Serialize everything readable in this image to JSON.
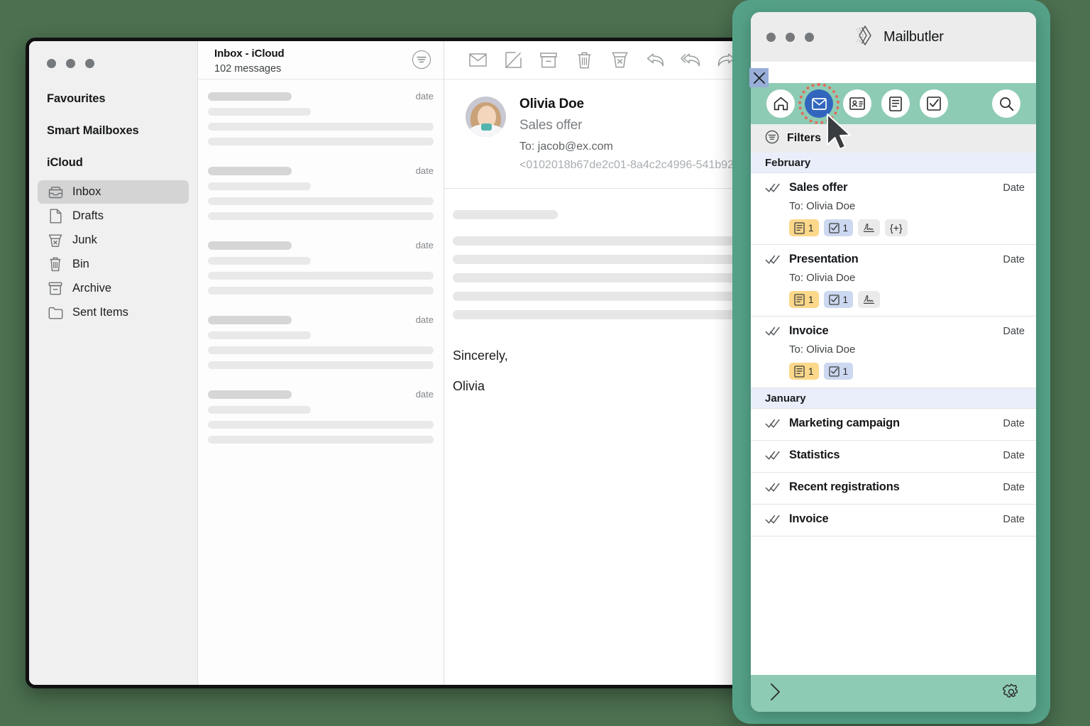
{
  "background_color": "#4c7050",
  "mail_app": {
    "traffic_lights": [
      "close",
      "minimize",
      "zoom"
    ],
    "sidebar": {
      "groups": [
        {
          "label": "Favourites"
        },
        {
          "label": "Smart Mailboxes"
        },
        {
          "label": "iCloud"
        }
      ],
      "mailboxes": [
        {
          "label": "Inbox",
          "icon": "inbox-icon",
          "selected": true
        },
        {
          "label": "Drafts",
          "icon": "document-icon",
          "selected": false
        },
        {
          "label": "Junk",
          "icon": "junk-icon",
          "selected": false
        },
        {
          "label": "Bin",
          "icon": "trash-icon",
          "selected": false
        },
        {
          "label": "Archive",
          "icon": "archive-icon",
          "selected": false
        },
        {
          "label": "Sent Items",
          "icon": "folder-icon",
          "selected": false
        }
      ]
    },
    "message_list": {
      "title": "Inbox - iCloud",
      "count_label": "102 messages",
      "sort_icon": "sort-filter-icon",
      "placeholder_date": "date",
      "skeleton_rows": 5
    },
    "toolbar": [
      {
        "name": "mark-unread-button",
        "icon": "envelope-icon"
      },
      {
        "name": "compose-button",
        "icon": "compose-icon"
      },
      {
        "name": "archive-button",
        "icon": "archive-icon"
      },
      {
        "name": "delete-button",
        "icon": "trash-icon"
      },
      {
        "name": "junk-button",
        "icon": "junk-icon"
      },
      {
        "name": "reply-button",
        "icon": "reply-icon"
      },
      {
        "name": "reply-all-button",
        "icon": "reply-all-icon"
      },
      {
        "name": "forward-button",
        "icon": "forward-icon"
      }
    ],
    "reading_pane": {
      "sender": "Olivia Doe",
      "subject": "Sales offer",
      "to": "To: jacob@ex.com",
      "message_id": "<0102018b67de2c01-8a4c2c4996-541b92",
      "signoff_line1": "Sincerely,",
      "signoff_line2": "Olivia"
    }
  },
  "mailbutler": {
    "titlebar": {
      "brand": "Mailbutler",
      "logo_icon": "mailbutler-diamond-logo"
    },
    "close_badge": {
      "icon": "close-x-icon",
      "color": "#98aed8"
    },
    "toolbar": {
      "accent_color": "#8ecbb4",
      "active_color": "#3266bd",
      "highlight_ring_color": "#e2695b",
      "items": [
        {
          "name": "home-tab",
          "icon": "home-icon",
          "active": false
        },
        {
          "name": "messages-tab",
          "icon": "envelope-icon",
          "active": true,
          "highlighted": true
        },
        {
          "name": "contacts-tab",
          "icon": "contact-card-icon",
          "active": false
        },
        {
          "name": "notes-tab",
          "icon": "notes-icon",
          "active": false
        },
        {
          "name": "tasks-tab",
          "icon": "checkbox-icon",
          "active": false
        }
      ],
      "search": {
        "name": "search-button",
        "icon": "search-icon"
      }
    },
    "filters_row": {
      "label": "Filters",
      "icon": "filter-icon"
    },
    "sections": [
      {
        "month": "February",
        "items": [
          {
            "title": "Sales offer",
            "to": "To: Olivia Doe",
            "date": "Date",
            "status_icon": "double-check-icon",
            "badges": [
              {
                "type": "note",
                "icon": "note-icon",
                "count": "1"
              },
              {
                "type": "task",
                "icon": "task-icon",
                "count": "1"
              },
              {
                "type": "sig",
                "icon": "signature-icon",
                "count": ""
              },
              {
                "type": "tpl",
                "icon": "template-icon",
                "count": "{+}"
              }
            ]
          },
          {
            "title": "Presentation",
            "to": "To: Olivia Doe",
            "date": "Date",
            "status_icon": "double-check-icon",
            "badges": [
              {
                "type": "note",
                "icon": "note-icon",
                "count": "1"
              },
              {
                "type": "task",
                "icon": "task-icon",
                "count": "1"
              },
              {
                "type": "sig",
                "icon": "signature-icon",
                "count": ""
              }
            ]
          },
          {
            "title": "Invoice",
            "to": "To: Olivia Doe",
            "date": "Date",
            "status_icon": "double-check-icon",
            "badges": [
              {
                "type": "note",
                "icon": "note-icon",
                "count": "1"
              },
              {
                "type": "task",
                "icon": "task-icon",
                "count": "1"
              }
            ]
          }
        ]
      },
      {
        "month": "January",
        "items": [
          {
            "title": "Marketing campaign",
            "date": "Date",
            "status_icon": "double-check-icon",
            "compact": true
          },
          {
            "title": "Statistics",
            "date": "Date",
            "status_icon": "double-check-icon",
            "compact": true
          },
          {
            "title": "Recent registrations",
            "date": "Date",
            "status_icon": "double-check-icon",
            "compact": true
          },
          {
            "title": "Invoice",
            "date": "Date",
            "status_icon": "double-check-icon",
            "compact": true
          }
        ]
      }
    ],
    "bottombar": {
      "expand": {
        "name": "expand-button",
        "icon": "chevron-right-icon"
      },
      "settings": {
        "name": "settings-button",
        "icon": "gear-icon"
      }
    }
  }
}
